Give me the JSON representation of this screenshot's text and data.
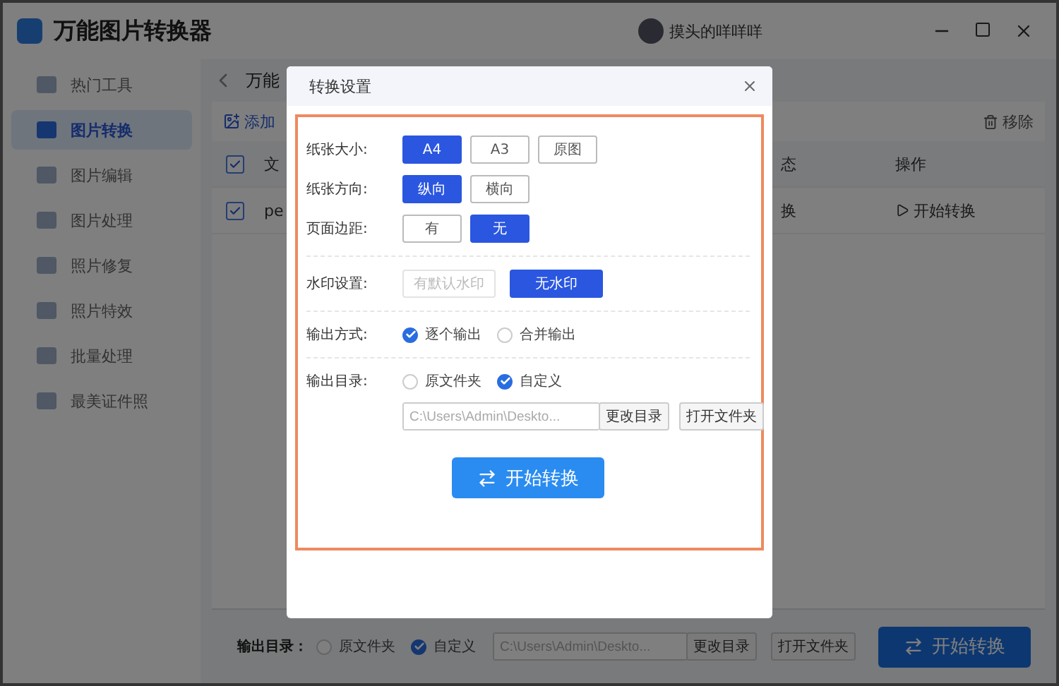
{
  "app": {
    "title": "万能图片转换器",
    "user": "摸头的咩咩咩"
  },
  "sidebar": {
    "items": [
      {
        "label": "热门工具",
        "selected": false
      },
      {
        "label": "图片转换",
        "selected": true
      },
      {
        "label": "图片编辑",
        "selected": false
      },
      {
        "label": "图片处理",
        "selected": false
      },
      {
        "label": "照片修复",
        "selected": false
      },
      {
        "label": "照片特效",
        "selected": false
      },
      {
        "label": "批量处理",
        "selected": false
      },
      {
        "label": "最美证件照",
        "selected": false
      }
    ]
  },
  "tabs": [
    {
      "label": "万能",
      "selected": true
    }
  ],
  "toolbar": {
    "add": "添加",
    "remove": "移除"
  },
  "table": {
    "all_checked": true,
    "columns": [
      "文",
      "态",
      "操作"
    ],
    "rows": [
      {
        "checked": true,
        "cells": [
          "pe",
          "换",
          "开始转换"
        ]
      }
    ]
  },
  "footer": {
    "label": "输出目录：",
    "options": [
      {
        "label": "原文件夹",
        "selected": false
      },
      {
        "label": "自定义",
        "selected": true
      }
    ],
    "path": "C:\\Users\\Admin\\Deskto...",
    "change": "更改目录",
    "open": "打开文件夹",
    "start": "开始转换"
  },
  "dialog": {
    "title": "转换设置",
    "sections": [
      [
        {
          "kind": "buttons",
          "label": "纸张大小:",
          "options": [
            {
              "label": "A4",
              "selected": true
            },
            {
              "label": "A3",
              "selected": false
            },
            {
              "label": "原图",
              "selected": false
            }
          ]
        },
        {
          "kind": "buttons",
          "label": "纸张方向:",
          "options": [
            {
              "label": "纵向",
              "selected": true
            },
            {
              "label": "横向",
              "selected": false
            }
          ]
        },
        {
          "kind": "buttons",
          "label": "页面边距:",
          "options": [
            {
              "label": "有",
              "selected": false
            },
            {
              "label": "无",
              "selected": true
            }
          ]
        }
      ],
      [
        {
          "kind": "wide",
          "label": "水印设置:",
          "options": [
            {
              "label": "有默认水印",
              "selected": false
            },
            {
              "label": "无水印",
              "selected": true
            }
          ]
        }
      ],
      [
        {
          "kind": "radio",
          "label": "输出方式:",
          "options": [
            {
              "label": "逐个输出",
              "selected": true
            },
            {
              "label": "合并输出",
              "selected": false
            }
          ]
        }
      ],
      [
        {
          "kind": "directory",
          "label": "输出目录:",
          "options": [
            {
              "label": "原文件夹",
              "selected": false
            },
            {
              "label": "自定义",
              "selected": true
            }
          ],
          "path": "C:\\Users\\Admin\\Deskto...",
          "change": "更改目录",
          "open": "打开文件夹"
        }
      ]
    ],
    "start": "开始转换"
  }
}
